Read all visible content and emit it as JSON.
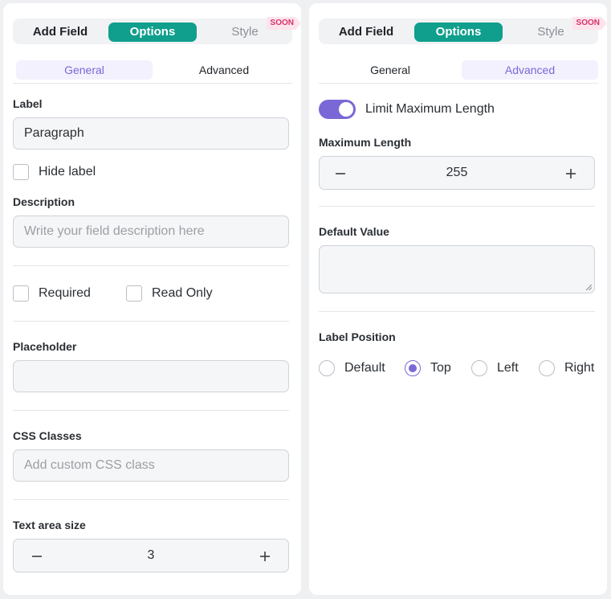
{
  "tabs": {
    "add_field": "Add Field",
    "options": "Options",
    "style": "Style",
    "soon_badge": "SOON"
  },
  "subtabs": {
    "general": "General",
    "advanced": "Advanced"
  },
  "general": {
    "label_title": "Label",
    "label_value": "Paragraph",
    "hide_label": "Hide label",
    "description_title": "Description",
    "description_placeholder": "Write your field description here",
    "required": "Required",
    "read_only": "Read Only",
    "placeholder_title": "Placeholder",
    "placeholder_value": "",
    "css_title": "CSS Classes",
    "css_placeholder": "Add custom CSS class",
    "textarea_size_title": "Text area size",
    "textarea_size_value": "3"
  },
  "advanced": {
    "limit_max_length": "Limit Maximum Length",
    "limit_enabled": true,
    "max_length_title": "Maximum Length",
    "max_length_value": "255",
    "default_value_title": "Default Value",
    "default_value": "",
    "label_position_title": "Label Position",
    "label_positions": [
      "Default",
      "Top",
      "Left",
      "Right"
    ],
    "label_position_selected": "Top"
  },
  "colors": {
    "accent_teal": "#0f9f8c",
    "accent_purple": "#7a68d6",
    "soon_pink": "#d6336c"
  },
  "icons": {
    "minus": "minus-icon",
    "plus": "plus-icon"
  }
}
